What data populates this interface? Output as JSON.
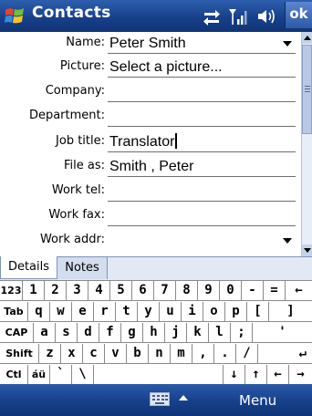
{
  "app": {
    "title": "Contacts",
    "ok_label": "ok",
    "accent": "#17408a"
  },
  "status_icons": [
    "sync-icon",
    "signal-icon",
    "volume-icon"
  ],
  "form": {
    "fields": [
      {
        "label": "Name:",
        "value": "Peter Smith",
        "type": "dropdown"
      },
      {
        "label": "Picture:",
        "value": "Select a picture...",
        "type": "link"
      },
      {
        "label": "Company:",
        "value": "",
        "type": "text"
      },
      {
        "label": "Department:",
        "value": "",
        "type": "text"
      },
      {
        "label": "Job title:",
        "value": "Translator",
        "type": "text",
        "focused": true
      },
      {
        "label": "File as:",
        "value": "Smith , Peter",
        "type": "text"
      },
      {
        "label": "Work tel:",
        "value": "",
        "type": "text"
      },
      {
        "label": "Work fax:",
        "value": "",
        "type": "text"
      },
      {
        "label": "Work addr:",
        "value": "",
        "type": "dropdown"
      }
    ]
  },
  "tabs": [
    {
      "label": "Details",
      "active": true
    },
    {
      "label": "Notes",
      "active": false
    }
  ],
  "keyboard": {
    "rows": [
      [
        "123",
        "1",
        "2",
        "3",
        "4",
        "5",
        "6",
        "7",
        "8",
        "9",
        "0",
        "-",
        "=",
        "←"
      ],
      [
        "Tab",
        "q",
        "w",
        "e",
        "r",
        "t",
        "y",
        "u",
        "i",
        "o",
        "p",
        "[",
        "]"
      ],
      [
        "CAP",
        "a",
        "s",
        "d",
        "f",
        "g",
        "h",
        "j",
        "k",
        "l",
        ";",
        "'"
      ],
      [
        "Shift",
        "z",
        "x",
        "c",
        "v",
        "b",
        "n",
        "m",
        ",",
        ".",
        "/",
        "↵"
      ],
      [
        "Ctl",
        "áü",
        "`",
        "\\",
        "",
        "↓",
        "↑",
        "←",
        "→"
      ]
    ]
  },
  "menubar": {
    "menu_label": "Menu"
  }
}
